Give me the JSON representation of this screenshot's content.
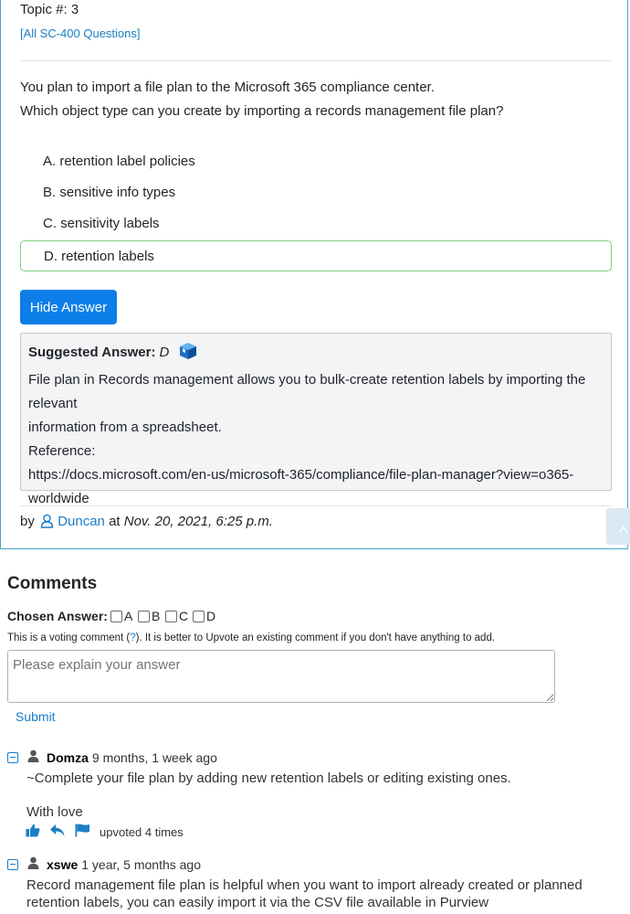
{
  "question": {
    "topic": "Topic #: 3",
    "all_questions_link": "[All SC-400 Questions]",
    "text_line1": "You plan to import a file plan to the Microsoft 365 compliance center.",
    "text_line2": "Which object type can you create by importing a records management file plan?",
    "choices": [
      {
        "label": "A. retention label policies"
      },
      {
        "label": "B. sensitive info types"
      },
      {
        "label": "C. sensitivity labels"
      },
      {
        "label": "D. retention labels"
      }
    ],
    "hide_answer_label": "Hide Answer",
    "suggested_label": "Suggested Answer:",
    "suggested_letter": "D",
    "explanation_line1": "File plan in Records management allows you to bulk-create retention labels by importing the relevant",
    "explanation_line2": "information from a spreadsheet.",
    "reference_label": "Reference:",
    "reference_url_line1": "https://docs.microsoft.com/en-us/microsoft-365/compliance/file-plan-manager?view=o365-",
    "reference_url_line2": "worldwide",
    "by_label": "by",
    "author": "Duncan",
    "at_label": "at",
    "date": "Nov. 20, 2021, 6:25 p.m."
  },
  "comments": {
    "heading": "Comments",
    "chosen_answer_label": "Chosen Answer:",
    "options": [
      "A",
      "B",
      "C",
      "D"
    ],
    "vote_note_pre": "This is a voting comment (",
    "vote_note_q": "?",
    "vote_note_post": "). It is better to Upvote an existing comment if you don't have anything to add.",
    "placeholder": "Please explain your answer",
    "submit_label": "Submit",
    "items": [
      {
        "user": "Domza",
        "time": "9 months, 1 week ago",
        "body_line1": "~Complete your file plan by adding new retention labels or editing existing ones.",
        "body_line2": "With love",
        "upvotes": "upvoted 4 times"
      },
      {
        "user": "xswe",
        "time": "1 year, 5 months ago",
        "body_line1": "Record management file plan is helpful when you want to import already created or planned",
        "body_line2": "retention labels, you can easily import it via the CSV file available in Purview"
      }
    ]
  },
  "colors": {
    "accent": "#0d7ee8",
    "link": "#1a7dc6",
    "correct_border": "#7ed07e"
  },
  "icons": [
    "cube-icon",
    "user-outline-icon",
    "collapse-icon",
    "user-icon",
    "thumbs-up-icon",
    "reply-icon",
    "flag-icon",
    "chevron-up-icon"
  ]
}
